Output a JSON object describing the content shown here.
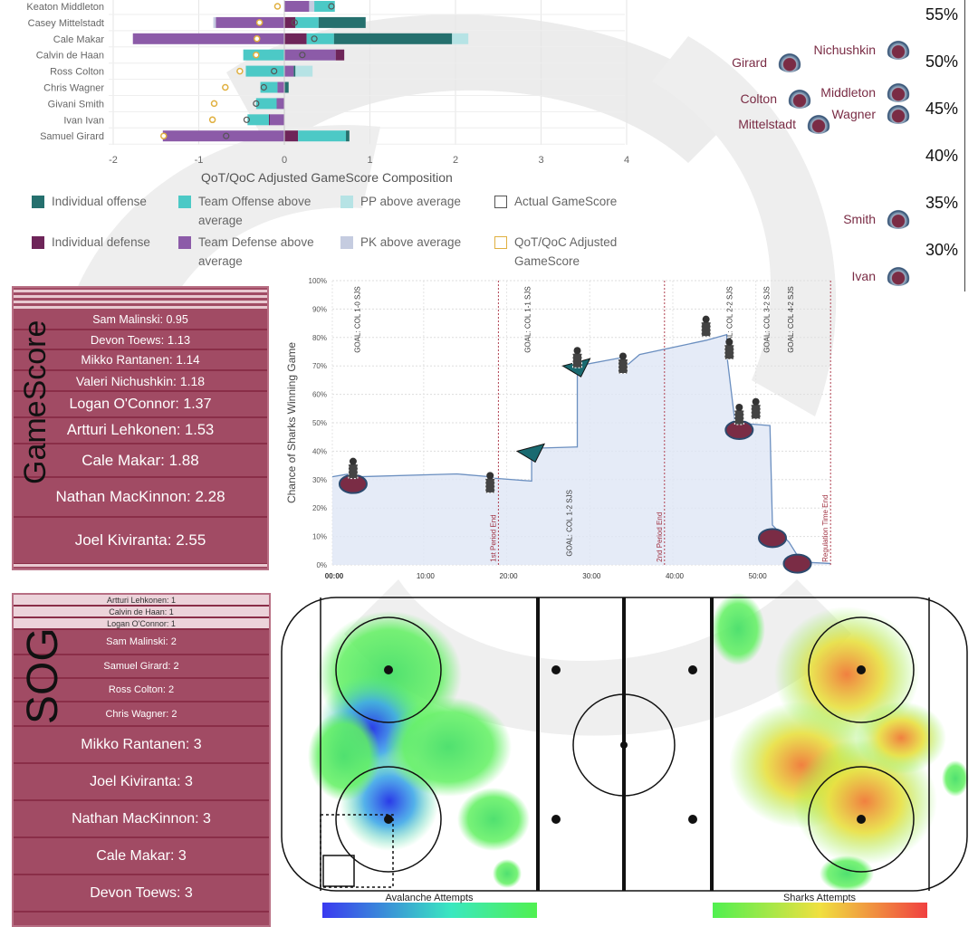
{
  "composition_chart": {
    "type": "bar",
    "orientation": "horizontal",
    "stacked": true,
    "xlabel": "QoT/QoC Adjusted GameScore Composition",
    "xlim": [
      -2,
      4
    ],
    "xticks": [
      -2,
      -1,
      0,
      1,
      2,
      3,
      4
    ],
    "grid": true,
    "legend": [
      {
        "key": "ind_off",
        "label": "Individual offense",
        "color": "#25706e"
      },
      {
        "key": "team_off",
        "label": "Team Offense above average",
        "color": "#4cc9c6"
      },
      {
        "key": "pp",
        "label": "PP above average",
        "color": "#b6e3e5"
      },
      {
        "key": "actual",
        "label": "Actual GameScore",
        "color": "#555555"
      },
      {
        "key": "ind_def",
        "label": "Individual defense",
        "color": "#6e2559"
      },
      {
        "key": "team_def",
        "label": "Team Defense above average",
        "color": "#8c5ba8"
      },
      {
        "key": "pk",
        "label": "PK above average",
        "color": "#c5cce0"
      },
      {
        "key": "adjusted",
        "label": "QoT/QoC Adjusted GameScore",
        "color": "#e0b040"
      }
    ],
    "players": [
      {
        "name": "Keaton Middleton",
        "segments": [
          [
            0,
            0.29,
            "team_def"
          ],
          [
            0.29,
            0.35,
            "pk"
          ],
          [
            0.35,
            0.59,
            "team_off"
          ]
        ],
        "actual": 0.55,
        "adjusted": -0.08
      },
      {
        "name": "Casey Mittelstadt",
        "segments": [
          [
            -0.83,
            -0.8,
            "pk"
          ],
          [
            -0.8,
            0,
            "team_def"
          ],
          [
            0,
            0.13,
            "ind_def"
          ],
          [
            0.13,
            0.4,
            "team_off"
          ],
          [
            0.4,
            0.95,
            "ind_off"
          ]
        ],
        "actual": 0.12,
        "adjusted": -0.29
      },
      {
        "name": "Cale Makar",
        "segments": [
          [
            -1.77,
            0,
            "team_def"
          ],
          [
            0,
            0.26,
            "ind_def"
          ],
          [
            0.26,
            0.58,
            "team_off"
          ],
          [
            0.58,
            1.96,
            "ind_off"
          ],
          [
            1.96,
            2.15,
            "pp"
          ]
        ],
        "actual": 0.35,
        "adjusted": -0.32
      },
      {
        "name": "Calvin de Haan",
        "segments": [
          [
            -0.48,
            0,
            "team_off"
          ],
          [
            0,
            0.6,
            "team_def"
          ],
          [
            0.6,
            0.7,
            "ind_def"
          ]
        ],
        "actual": 0.21,
        "adjusted": -0.33
      },
      {
        "name": "Ross Colton",
        "segments": [
          [
            -0.45,
            0,
            "team_off"
          ],
          [
            0,
            0.11,
            "team_def"
          ],
          [
            0.11,
            0.13,
            "ind_off"
          ],
          [
            0.13,
            0.33,
            "pp"
          ]
        ],
        "actual": -0.12,
        "adjusted": -0.52
      },
      {
        "name": "Chris Wagner",
        "segments": [
          [
            -0.28,
            -0.08,
            "team_off"
          ],
          [
            -0.08,
            0,
            "team_def"
          ],
          [
            0,
            0.05,
            "ind_off"
          ]
        ],
        "actual": -0.24,
        "adjusted": -0.69
      },
      {
        "name": "Givani Smith",
        "segments": [
          [
            -0.33,
            -0.09,
            "team_off"
          ],
          [
            -0.09,
            0,
            "team_def"
          ]
        ],
        "actual": -0.33,
        "adjusted": -0.82
      },
      {
        "name": "Ivan Ivan",
        "segments": [
          [
            -0.43,
            -0.18,
            "team_off"
          ],
          [
            -0.18,
            -0.17,
            "ind_def"
          ],
          [
            -0.17,
            0,
            "team_def"
          ]
        ],
        "actual": -0.44,
        "adjusted": -0.84
      },
      {
        "name": "Samuel Girard",
        "segments": [
          [
            -1.42,
            0,
            "team_def"
          ],
          [
            0,
            0.16,
            "ind_def"
          ],
          [
            0.16,
            0.72,
            "team_off"
          ],
          [
            0.72,
            0.76,
            "ind_off"
          ]
        ],
        "actual": -0.68,
        "adjusted": -1.41
      }
    ]
  },
  "rating_panel": {
    "ticks": [
      "55%",
      "50%",
      "45%",
      "40%",
      "35%",
      "30%"
    ],
    "tick_values": [
      55,
      50,
      45,
      40,
      35,
      30
    ],
    "players": [
      {
        "name": "Nichushkin",
        "value": 51.3
      },
      {
        "name": "Girard",
        "value": 50.0
      },
      {
        "name": "Middleton",
        "value": 46.8
      },
      {
        "name": "Colton",
        "value": 46.2
      },
      {
        "name": "Wagner",
        "value": 44.5
      },
      {
        "name": "Mittelstadt",
        "value": 43.5
      },
      {
        "name": "Smith",
        "value": 33.4
      },
      {
        "name": "Ivan",
        "value": 27.3
      }
    ]
  },
  "gamescore": {
    "title": "GameScore",
    "items": [
      "Sam Malinski: 0.95",
      "Devon Toews: 1.13",
      "Mikko Rantanen: 1.14",
      "Valeri Nichushkin: 1.18",
      "Logan O'Connor: 1.37",
      "Artturi Lehkonen: 1.53",
      "Cale Makar: 1.88",
      "Nathan MacKinnon: 2.28",
      "Joel Kiviranta: 2.55"
    ]
  },
  "sog": {
    "title": "SOG",
    "items": [
      "Artturi Lehkonen: 1",
      "Calvin de Haan: 1",
      "Logan O'Connor: 1",
      "Sam Malinski: 2",
      "Samuel Girard: 2",
      "Ross Colton: 2",
      "Chris Wagner: 2",
      "Mikko Rantanen: 3",
      "Joel Kiviranta: 3",
      "Nathan MacKinnon: 3",
      "Cale Makar: 3",
      "Devon Toews: 3"
    ]
  },
  "chart_data": {
    "type": "area",
    "ylabel": "Chance of Sharks Winning Game",
    "ylim": [
      0,
      100
    ],
    "yticks": [
      "0%",
      "10%",
      "20%",
      "30%",
      "40%",
      "50%",
      "60%",
      "70%",
      "80%",
      "90%",
      "100%"
    ],
    "xticks": [
      "00:00",
      "10:00",
      "20:00",
      "30:00",
      "40:00",
      "50:00"
    ],
    "xlim": [
      0,
      60
    ],
    "grid": true,
    "points": [
      [
        0,
        31
      ],
      [
        2,
        32
      ],
      [
        3,
        31
      ],
      [
        15,
        32
      ],
      [
        19,
        31
      ],
      [
        19.5,
        30.5
      ],
      [
        24,
        29.5
      ],
      [
        24,
        41
      ],
      [
        29.5,
        41.5
      ],
      [
        29.5,
        70
      ],
      [
        35,
        73
      ],
      [
        35,
        69
      ],
      [
        37,
        74
      ],
      [
        45,
        79
      ],
      [
        47.5,
        81
      ],
      [
        47.5,
        74
      ],
      [
        48.5,
        50
      ],
      [
        52.7,
        49
      ],
      [
        53,
        14
      ],
      [
        55,
        8
      ],
      [
        56.5,
        1
      ],
      [
        60,
        0.5
      ]
    ],
    "annotations": [
      {
        "label": "GOAL: COL 1-0 SJS",
        "minute": 3,
        "pos": "top"
      },
      {
        "label": "GOAL: COL 1-1 SJS",
        "minute": 23.5,
        "pos": "top"
      },
      {
        "label": "GOAL: COL 1-2 SJS",
        "minute": 28.5,
        "pos": "bottom"
      },
      {
        "label": "GOAL: COL 2-2 SJS",
        "minute": 47.8,
        "pos": "top"
      },
      {
        "label": "GOAL: COL 3-2 SJS",
        "minute": 52.3,
        "pos": "top"
      },
      {
        "label": "GOAL: COL 4-2 SJS",
        "minute": 55.2,
        "pos": "top"
      }
    ],
    "period_lines": [
      {
        "label": "1st Period End",
        "minute": 20
      },
      {
        "label": "2nd Period End",
        "minute": 40
      },
      {
        "label": "Regulation Time End",
        "minute": 60
      }
    ],
    "events": [
      {
        "type": "penalty-col-goal",
        "minute": 2.5,
        "value": 31
      },
      {
        "type": "penalty",
        "minute": 19,
        "value": 26
      },
      {
        "type": "sjs-goal",
        "minute": 24,
        "value": 40
      },
      {
        "type": "penalty-sjs-goal",
        "minute": 29.5,
        "value": 70
      },
      {
        "type": "penalty",
        "minute": 35,
        "value": 68
      },
      {
        "type": "penalty",
        "minute": 45,
        "value": 81
      },
      {
        "type": "penalty",
        "minute": 47.8,
        "value": 73
      },
      {
        "type": "penalty-col-goal",
        "minute": 49,
        "value": 50
      },
      {
        "type": "penalty",
        "minute": 51,
        "value": 52
      },
      {
        "type": "col-goal",
        "minute": 53,
        "value": 12
      },
      {
        "type": "col-goal",
        "minute": 56,
        "value": 3
      }
    ]
  },
  "rink": {
    "left_label": "Avalanche Attempts",
    "right_label": "Sharks Attempts",
    "left_colors": [
      "#3a3af0",
      "#3ae8a0",
      "#50f050"
    ],
    "right_colors": [
      "#50f050",
      "#f0e040",
      "#f04040"
    ]
  }
}
